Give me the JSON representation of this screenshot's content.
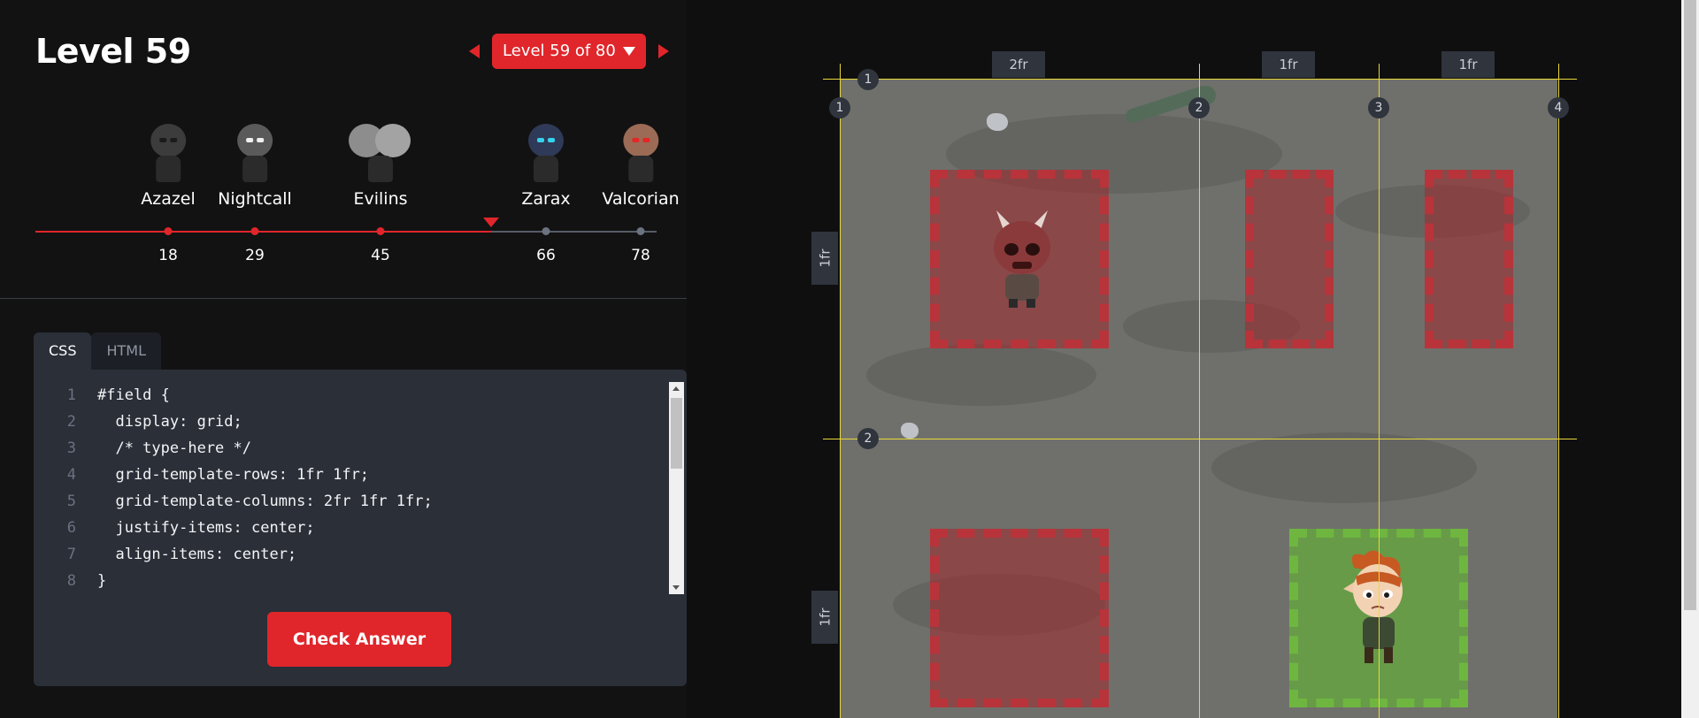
{
  "level": {
    "title": "Level 59",
    "selector_label": "Level 59 of 80"
  },
  "bosses": [
    {
      "name": "Azazel",
      "level": "18",
      "head_color": "#3c3c3c",
      "eye_color": "#1b1b1b"
    },
    {
      "name": "Nightcall",
      "level": "29",
      "head_color": "#5a5a5a",
      "eye_color": "#f0f0f0"
    },
    {
      "name": "Evilins",
      "level": "45",
      "head_color": "#8d8d8d",
      "eye_color": "#2a2a2a"
    },
    {
      "name": "Zarax",
      "level": "66",
      "head_color": "#2f3a58",
      "eye_color": "#34d3ec"
    },
    {
      "name": "Valcorian",
      "level": "78",
      "head_color": "#9b6b55",
      "eye_color": "#e32626"
    }
  ],
  "editor": {
    "tabs": [
      "CSS",
      "HTML"
    ],
    "active_tab": "CSS",
    "lines": [
      {
        "n": "1",
        "code": "#field {"
      },
      {
        "n": "2",
        "code": "  display: grid;"
      },
      {
        "n": "3",
        "code": "  /* type-here */"
      },
      {
        "n": "4",
        "code": "  grid-template-rows: 1fr 1fr;"
      },
      {
        "n": "5",
        "code": "  grid-template-columns: 2fr 1fr 1fr;"
      },
      {
        "n": "6",
        "code": "  justify-items: center;"
      },
      {
        "n": "7",
        "code": "  align-items: center;"
      },
      {
        "n": "8",
        "code": "}"
      }
    ],
    "check_label": "Check Answer"
  },
  "board": {
    "column_labels": [
      "2fr",
      "1fr",
      "1fr"
    ],
    "row_labels": [
      "1fr",
      "1fr"
    ],
    "column_lines": [
      "1",
      "2",
      "3",
      "4"
    ],
    "row_lines": [
      "1",
      "2"
    ]
  },
  "colors": {
    "accent": "#e0262b",
    "enemy_zone": "#b8343a",
    "goal_zone": "#6fb640",
    "grid_guide": "#e8d83a"
  }
}
